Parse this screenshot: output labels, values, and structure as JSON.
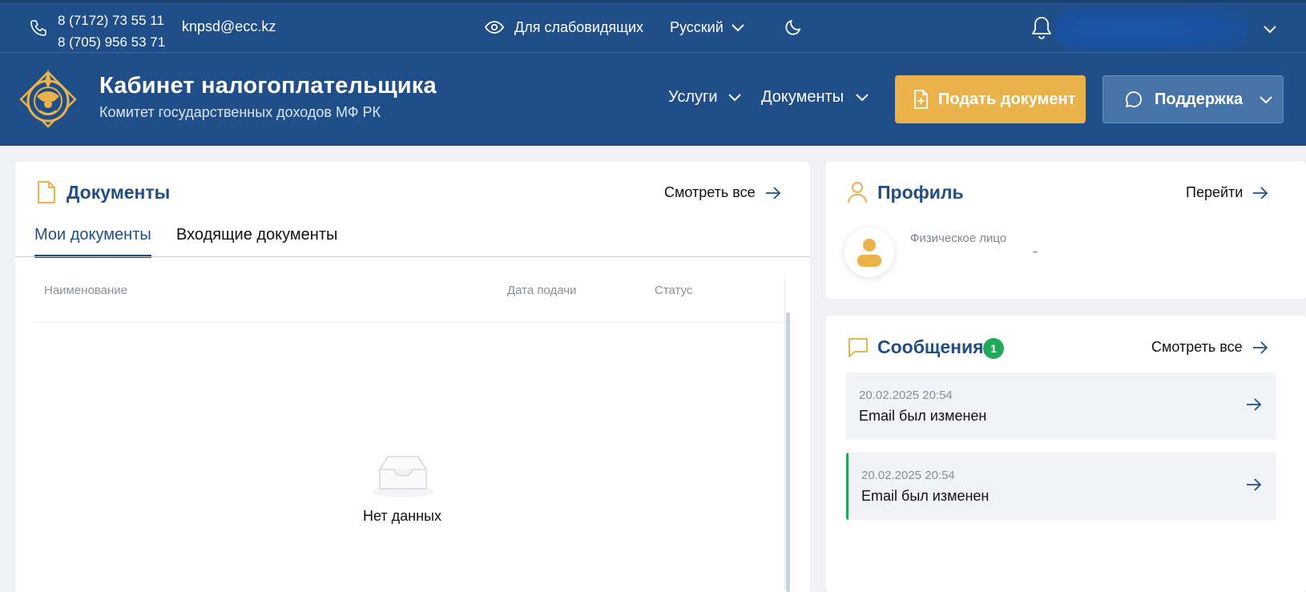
{
  "topbar": {
    "phones": [
      "8 (7172) 73 55 11",
      "8 (705) 956 53 71"
    ],
    "email": "knpsd@ecc.kz",
    "vision_label": "Для слабовидящих",
    "language": "Русский"
  },
  "header": {
    "title": "Кабинет налогоплательщика",
    "subtitle": "Комитет государственных доходов МФ РК",
    "nav": {
      "services": "Услуги",
      "documents": "Документы"
    },
    "submit_button": "Подать документ",
    "support_button": "Поддержка"
  },
  "documents": {
    "title": "Документы",
    "view_all": "Смотреть все",
    "tabs": [
      {
        "label": "Мои документы",
        "active": true
      },
      {
        "label": "Входящие документы",
        "active": false
      }
    ],
    "columns": [
      "Наименование",
      "Дата подачи",
      "Статус"
    ],
    "empty_text": "Нет данных"
  },
  "profile": {
    "title": "Профиль",
    "go_link": "Перейти",
    "person_type": "Физическое лицо"
  },
  "messages": {
    "title": "Сообщения",
    "badge_count": "1",
    "view_all": "Смотреть все",
    "items": [
      {
        "date": "20.02.2025 20:54",
        "text": "Email был изменен",
        "unread": false
      },
      {
        "date": "20.02.2025 20:54",
        "text": "Email был изменен",
        "unread": true
      }
    ]
  },
  "colors": {
    "primary": "#1f4e88",
    "accent": "#e9b24b",
    "success": "#22a85a"
  }
}
